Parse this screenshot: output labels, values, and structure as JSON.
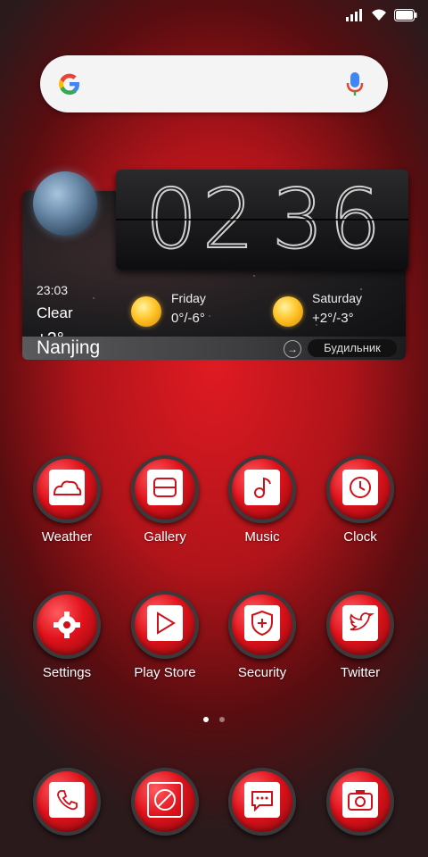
{
  "status_bar": {
    "icons": [
      "signal-icon",
      "wifi-icon",
      "battery-icon"
    ]
  },
  "search": {
    "logo": "google-logo",
    "mic": "microphone-icon"
  },
  "weather_widget": {
    "current_time": "23:03",
    "condition": "Clear",
    "temperature": "+2°",
    "city": "Nanjing",
    "clock": {
      "h1": "0",
      "h2": "2",
      "m1": "3",
      "m2": "6"
    },
    "forecast": [
      {
        "day": "Friday",
        "temp": "0°/-6°"
      },
      {
        "day": "Saturday",
        "temp": "+2°/-3°"
      }
    ],
    "alarm_label": "Будильник"
  },
  "apps": [
    {
      "label": "Weather",
      "icon": "cloud-icon"
    },
    {
      "label": "Gallery",
      "icon": "gallery-icon"
    },
    {
      "label": "Music",
      "icon": "music-note-icon"
    },
    {
      "label": "Clock",
      "icon": "clock-icon"
    },
    {
      "label": "Settings",
      "icon": "gear-icon"
    },
    {
      "label": "Play Store",
      "icon": "play-store-icon"
    },
    {
      "label": "Security",
      "icon": "shield-icon"
    },
    {
      "label": "Twitter",
      "icon": "twitter-bird-icon"
    }
  ],
  "dock": [
    {
      "icon": "phone-icon"
    },
    {
      "icon": "browser-icon"
    },
    {
      "icon": "messages-icon"
    },
    {
      "icon": "camera-icon"
    }
  ],
  "page_indicator": {
    "pages": 2,
    "current": 1
  }
}
